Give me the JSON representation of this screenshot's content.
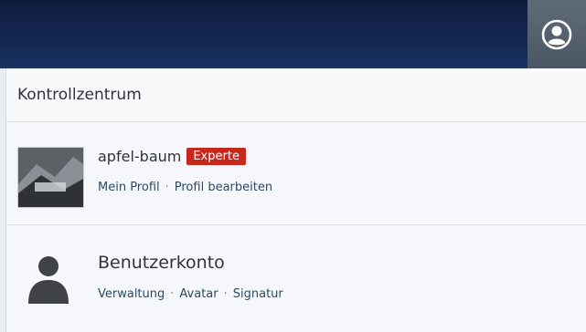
{
  "topbar": {
    "cut_text": "",
    "user_button_icon": "user-circle-icon"
  },
  "panel": {
    "title": "Kontrollzentrum",
    "profile": {
      "username": "apfel-baum",
      "badge": "Experte",
      "badge_color": "#c8281c",
      "links": [
        "Mein Profil",
        "Profil bearbeiten"
      ]
    },
    "account": {
      "title": "Benutzerkonto",
      "icon": "person-icon",
      "links": [
        "Verwaltung",
        "Avatar",
        "Signatur"
      ]
    }
  },
  "separator": "·"
}
